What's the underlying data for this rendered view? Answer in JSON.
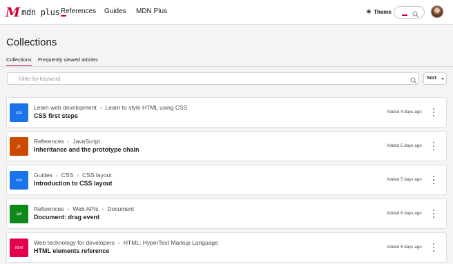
{
  "nav": {
    "logo_mark": "M",
    "logo_text": "mdn plus",
    "links": [
      "References",
      "Guides",
      "MDN Plus"
    ],
    "theme_label": "Theme",
    "brand_color": "#d30038"
  },
  "page": {
    "title": "Collections",
    "tabs": [
      "Collections",
      "Frequently viewed articles"
    ],
    "active_tab": "Collections"
  },
  "filter": {
    "placeholder": "Filter by keyword",
    "sort_label": "Sort"
  },
  "items": [
    {
      "badge": "css",
      "badge_color": "#1a73e8",
      "breadcrumbs": [
        "Learn web development",
        "Learn to style HTML using CSS"
      ],
      "title": "CSS first steps",
      "added": "Added 4 days ago"
    },
    {
      "badge": "js",
      "badge_color": "#cc4a00",
      "breadcrumbs": [
        "References",
        "JavaScript"
      ],
      "title": "Inheritance and the prototype chain",
      "added": "Added 5 days ago"
    },
    {
      "badge": "css",
      "badge_color": "#1a73e8",
      "breadcrumbs": [
        "Guides",
        "CSS",
        "CSS layout"
      ],
      "title": "Introduction to CSS layout",
      "added": "Added 5 days ago"
    },
    {
      "badge": "api",
      "badge_color": "#0f8a1a",
      "breadcrumbs": [
        "References",
        "Web APIs",
        "Document"
      ],
      "title": "Document: drag event",
      "added": "Added 6 days ago"
    },
    {
      "badge": "html",
      "badge_color": "#e3004d",
      "breadcrumbs": [
        "Web technology for developers",
        "HTML: HyperText Markup Language"
      ],
      "title": "HTML elements reference",
      "added": "Added 6 days ago"
    }
  ]
}
